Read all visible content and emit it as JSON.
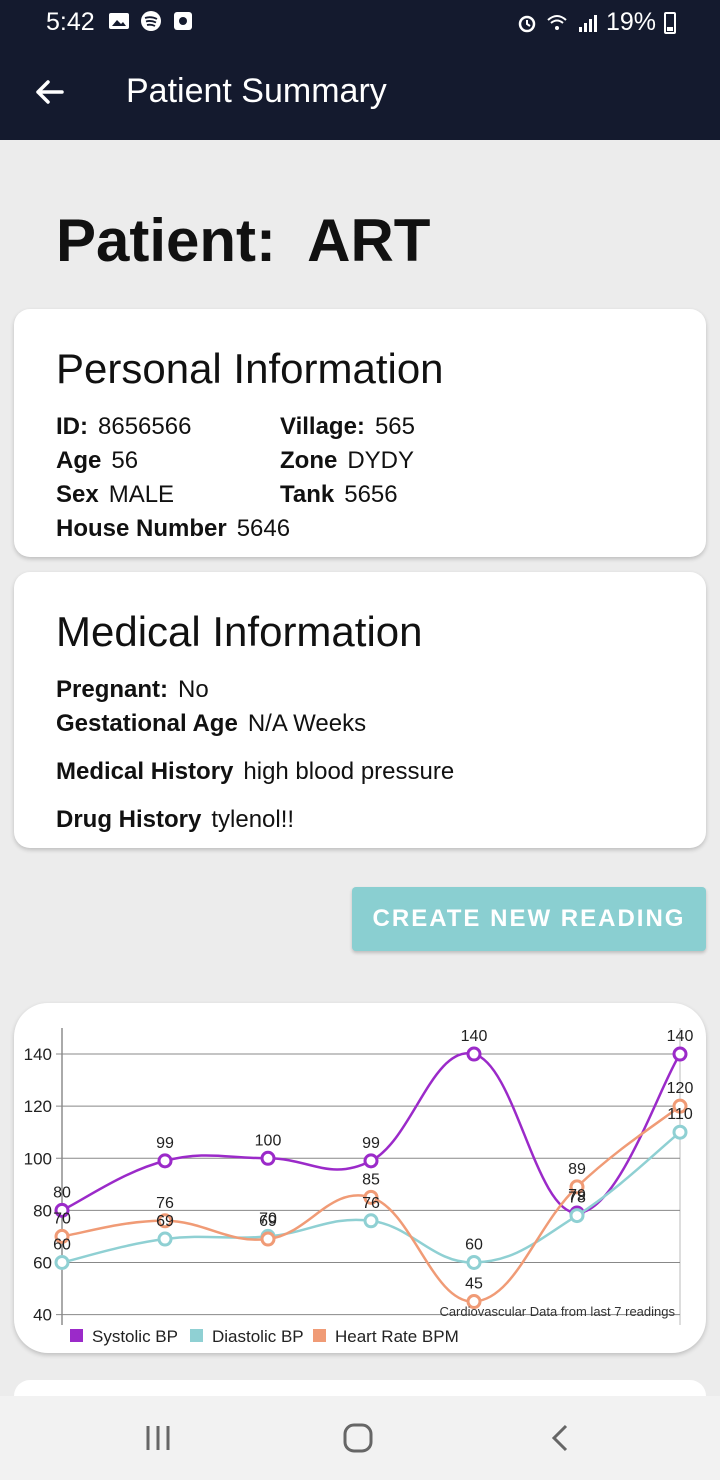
{
  "status": {
    "time": "5:42",
    "battery": "19%"
  },
  "appbar": {
    "title": "Patient Summary"
  },
  "patient": {
    "heading": "Patient:  ART"
  },
  "personal": {
    "title": "Personal Information",
    "id_label": "ID:",
    "id_value": "8656566",
    "village_label": "Village:",
    "village_value": "565",
    "age_label": "Age",
    "age_value": "56",
    "zone_label": "Zone",
    "zone_value": "DYDY",
    "sex_label": "Sex",
    "sex_value": "MALE",
    "tank_label": "Tank",
    "tank_value": "5656",
    "house_label": "House Number",
    "house_value": "5646"
  },
  "medical": {
    "title": "Medical Information",
    "pregnant_label": "Pregnant:",
    "pregnant_value": "No",
    "gest_label": "Gestational Age",
    "gest_value": "N/A Weeks",
    "history_label": "Medical History",
    "history_value": "high blood pressure",
    "drug_label": "Drug History",
    "drug_value": "tylenol!!"
  },
  "actions": {
    "create_reading": "CREATE NEW READING"
  },
  "chart_data": {
    "type": "line",
    "description": "Cardiovascular Data from last 7 readings",
    "x": [
      1,
      2,
      3,
      4,
      5,
      6,
      7
    ],
    "yticks": [
      40,
      60,
      80,
      100,
      120,
      140
    ],
    "ylim": [
      36,
      150
    ],
    "series": [
      {
        "name": "Systolic BP",
        "color": "#9b2ac9",
        "values": [
          80,
          99,
          100,
          99,
          140,
          79,
          140
        ]
      },
      {
        "name": "Diastolic BP",
        "color": "#8fd0d3",
        "values": [
          60,
          69,
          70,
          76,
          60,
          78,
          110
        ]
      },
      {
        "name": "Heart Rate BPM",
        "color": "#f09b76",
        "values": [
          70,
          76,
          69,
          85,
          45,
          89,
          120
        ]
      }
    ]
  },
  "icons": {
    "back": "arrow-left-icon",
    "nav_recent": "recent-apps-icon",
    "nav_home": "home-icon",
    "nav_back": "chevron-left-icon"
  }
}
